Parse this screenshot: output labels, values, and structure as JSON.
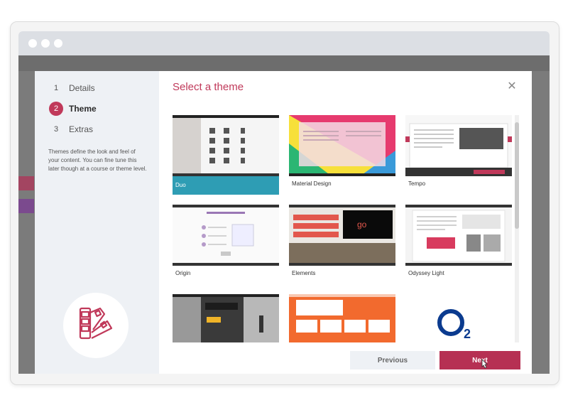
{
  "wizard": {
    "steps": [
      {
        "number": "1",
        "label": "Details"
      },
      {
        "number": "2",
        "label": "Theme"
      },
      {
        "number": "3",
        "label": "Extras"
      }
    ],
    "active_step": 2,
    "description": "Themes define the look and feel of your content. You can fine tune this later though at a course or theme level."
  },
  "dialog": {
    "title": "Select a theme",
    "close_icon": "close-icon"
  },
  "themes": [
    {
      "name": "Duo",
      "selected": true
    },
    {
      "name": "Material Design",
      "selected": false
    },
    {
      "name": "Tempo",
      "selected": false
    },
    {
      "name": "Origin",
      "selected": false
    },
    {
      "name": "Elements",
      "selected": false
    },
    {
      "name": "Odyssey Light",
      "selected": false
    },
    {
      "name": "",
      "selected": false
    },
    {
      "name": "",
      "selected": false
    },
    {
      "name": "",
      "selected": false
    }
  ],
  "footer": {
    "previous_label": "Previous",
    "next_label": "Next"
  },
  "colors": {
    "accent": "#c0395a",
    "next_button": "#b63053",
    "selected_card": "#2e9db4"
  }
}
